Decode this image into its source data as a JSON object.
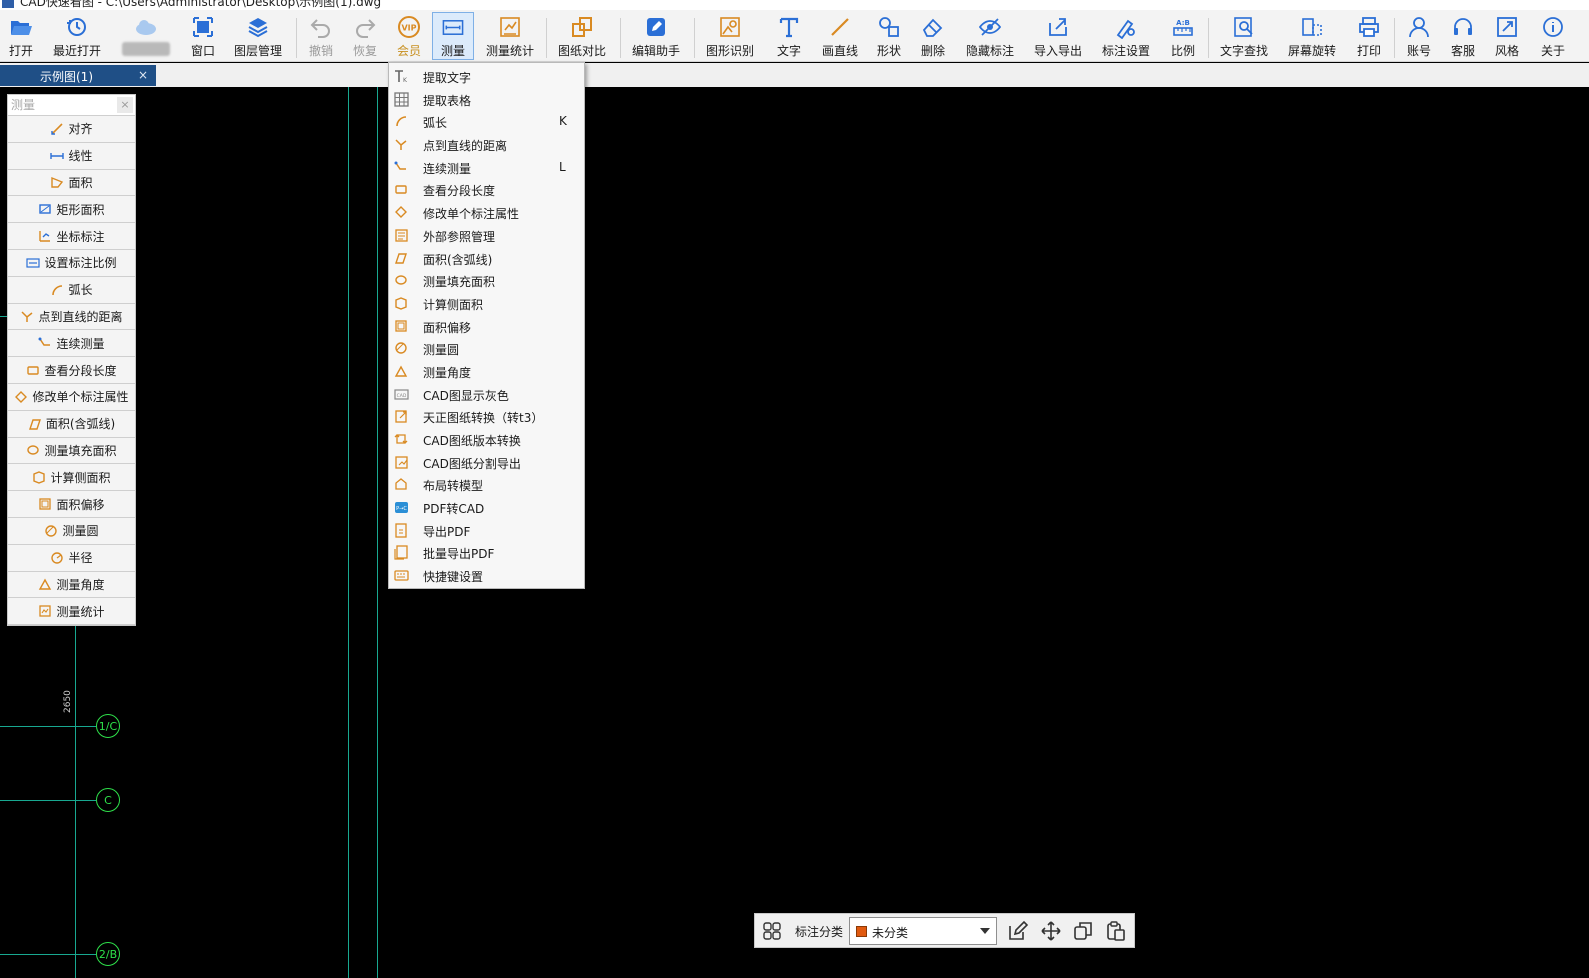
{
  "window": {
    "title": "CAD快速看图 - C:\\Users\\Administrator\\Desktop\\示例图(1).dwg"
  },
  "toolbar": {
    "items": [
      {
        "label": "打开",
        "icon": "folder-open-icon"
      },
      {
        "label": "最近打开",
        "icon": "history-icon"
      },
      {
        "label": "",
        "icon": "cloud-icon"
      },
      {
        "label": "窗口",
        "icon": "window-icon"
      },
      {
        "label": "图层管理",
        "icon": "layers-icon"
      },
      {
        "label": "撤销",
        "icon": "undo-icon"
      },
      {
        "label": "恢复",
        "icon": "redo-icon"
      },
      {
        "label": "会员",
        "icon": "vip-icon"
      },
      {
        "label": "测量",
        "icon": "measure-icon"
      },
      {
        "label": "测量统计",
        "icon": "measure-stats-icon"
      },
      {
        "label": "图纸对比",
        "icon": "compare-icon"
      },
      {
        "label": "编辑助手",
        "icon": "edit-assistant-icon"
      },
      {
        "label": "图形识别",
        "icon": "shape-recognition-icon"
      },
      {
        "label": "文字",
        "icon": "text-icon"
      },
      {
        "label": "画直线",
        "icon": "line-icon"
      },
      {
        "label": "形状",
        "icon": "shape-icon"
      },
      {
        "label": "删除",
        "icon": "eraser-icon"
      },
      {
        "label": "隐藏标注",
        "icon": "eye-hidden-icon"
      },
      {
        "label": "导入导出",
        "icon": "import-export-icon"
      },
      {
        "label": "标注设置",
        "icon": "annotation-settings-icon"
      },
      {
        "label": "比例",
        "icon": "scale-icon"
      },
      {
        "label": "文字查找",
        "icon": "text-search-icon"
      },
      {
        "label": "屏幕旋转",
        "icon": "rotate-screen-icon"
      },
      {
        "label": "打印",
        "icon": "print-icon"
      },
      {
        "label": "账号",
        "icon": "account-icon"
      },
      {
        "label": "客服",
        "icon": "headset-icon"
      },
      {
        "label": "风格",
        "icon": "style-icon"
      },
      {
        "label": "关于",
        "icon": "info-icon"
      }
    ]
  },
  "tabs": [
    {
      "label": "示例图(1)",
      "close": "×"
    }
  ],
  "drawing": {
    "dimension": "2650",
    "axis_labels": [
      "1/C",
      "C",
      "2/B"
    ]
  },
  "measure_panel": {
    "search_placeholder": "测量",
    "close": "×",
    "items": [
      "对齐",
      "线性",
      "面积",
      "矩形面积",
      "坐标标注",
      "设置标注比例",
      "弧长",
      "点到直线的距离",
      "连续测量",
      "查看分段长度",
      "修改单个标注属性",
      "面积(含弧线)",
      "测量填充面积",
      "计算侧面积",
      "面积偏移",
      "测量圆",
      "半径",
      "测量角度",
      "测量统计"
    ]
  },
  "dropdown_menu": {
    "items": [
      {
        "label": "提取文字",
        "key": ""
      },
      {
        "label": "提取表格",
        "key": ""
      },
      {
        "label": "弧长",
        "key": "K"
      },
      {
        "label": "点到直线的距离",
        "key": ""
      },
      {
        "label": "连续测量",
        "key": "L"
      },
      {
        "label": "查看分段长度",
        "key": ""
      },
      {
        "label": "修改单个标注属性",
        "key": ""
      },
      {
        "label": "外部参照管理",
        "key": ""
      },
      {
        "label": "面积(含弧线)",
        "key": ""
      },
      {
        "label": "测量填充面积",
        "key": ""
      },
      {
        "label": "计算侧面积",
        "key": ""
      },
      {
        "label": "面积偏移",
        "key": ""
      },
      {
        "label": "测量圆",
        "key": ""
      },
      {
        "label": "测量角度",
        "key": ""
      },
      {
        "label": "CAD图显示灰色",
        "key": ""
      },
      {
        "label": "天正图纸转换（转t3）",
        "key": ""
      },
      {
        "label": "CAD图纸版本转换",
        "key": ""
      },
      {
        "label": "CAD图纸分割导出",
        "key": ""
      },
      {
        "label": "布局转模型",
        "key": ""
      },
      {
        "label": "PDF转CAD",
        "key": ""
      },
      {
        "label": "导出PDF",
        "key": ""
      },
      {
        "label": "批量导出PDF",
        "key": ""
      },
      {
        "label": "快捷键设置",
        "key": ""
      }
    ]
  },
  "bottom_bar": {
    "label": "标注分类",
    "selected": "未分类",
    "swatch_color": "#e05a10"
  },
  "colors": {
    "accent": "#1f4f86",
    "icon_blue": "#2b6fd6",
    "icon_orange": "#d98a22",
    "cad_green": "#2ee04a",
    "cad_cyan": "#18a890"
  }
}
